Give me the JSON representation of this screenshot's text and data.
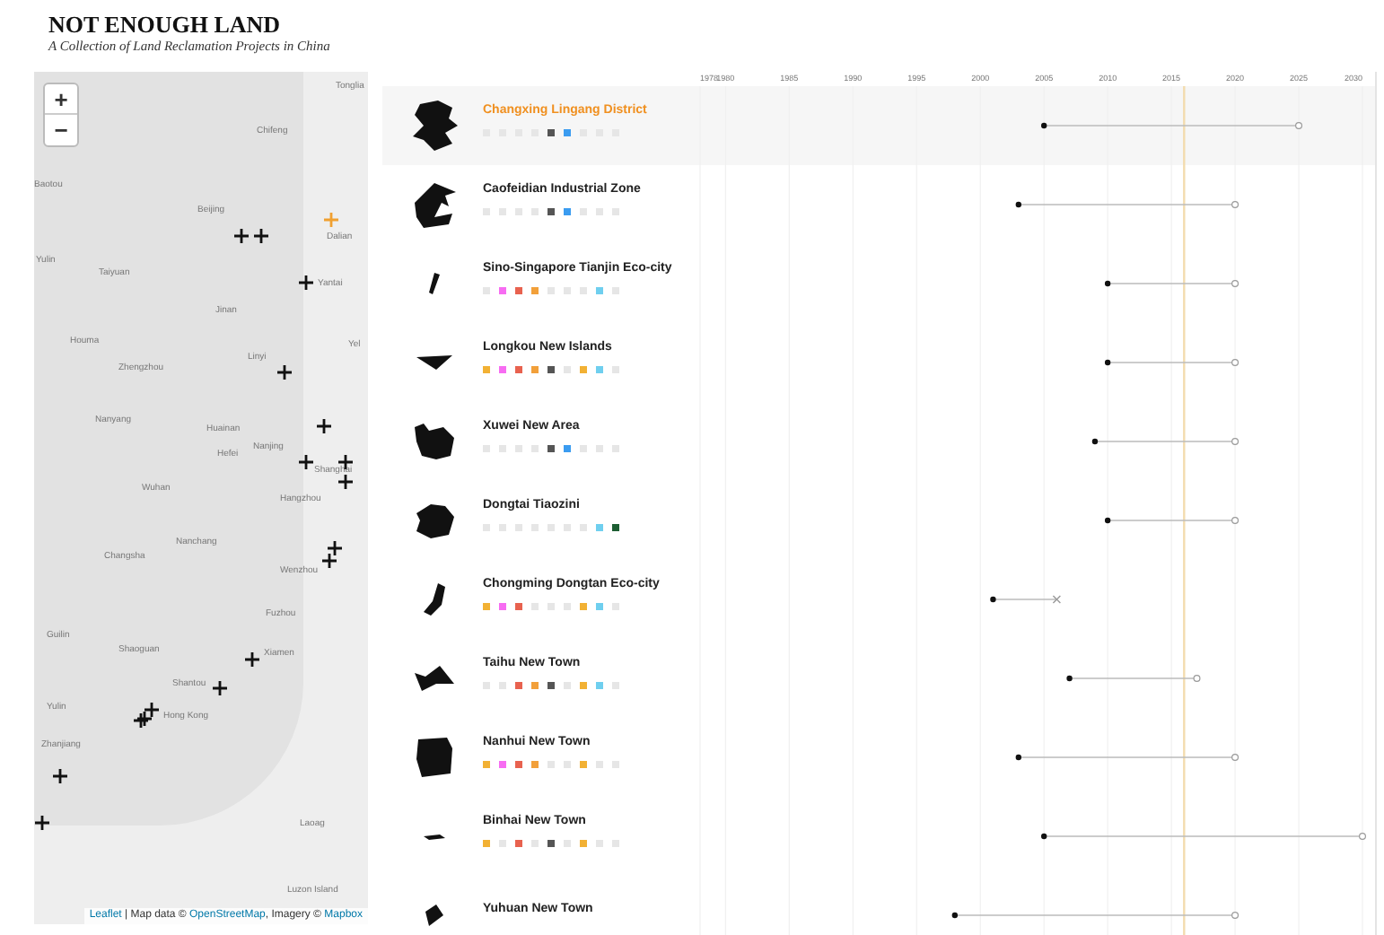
{
  "header": {
    "title": "NOT ENOUGH LAND",
    "subtitle": "A Collection of Land Reclamation Projects in China"
  },
  "map": {
    "zoom_in": "+",
    "zoom_out": "−",
    "labels": [
      "Tonglia",
      "Chifeng",
      "Baotou",
      "Beijing",
      "Dalian",
      "Yulin",
      "Taiyuan",
      "Yantai",
      "Jinan",
      "Houma",
      "Linyi",
      "Yel",
      "Zhengzhou",
      "Nanyang",
      "Huainan",
      "Nanjing",
      "Hefei",
      "Shanghai",
      "Wuhan",
      "Hangzhou",
      "Nanchang",
      "Changsha",
      "Wenzhou",
      "Fuzhou",
      "Guilin",
      "Shaoguan",
      "Xiamen",
      "Shantou",
      "Yulin",
      "Hong Kong",
      "Zhanjiang",
      "Laoag",
      "Luzon Island"
    ],
    "attribution": {
      "leaflet": "Leaflet",
      "sep": " | Map data © ",
      "osm": "OpenStreetMap",
      "imagery": ", Imagery © ",
      "mapbox": "Mapbox"
    }
  },
  "projects": [
    {
      "name": "Changxing Lingang District",
      "selected": true,
      "dots": [
        {
          "color": "#e6e6e6"
        },
        {
          "color": "#e6e6e6"
        },
        {
          "color": "#e6e6e6"
        },
        {
          "color": "#e6e6e6"
        },
        {
          "color": "#555555"
        },
        {
          "color": "#3b9cf0"
        },
        {
          "color": "#e6e6e6"
        },
        {
          "color": "#e6e6e6"
        },
        {
          "color": "#e6e6e6"
        }
      ]
    },
    {
      "name": "Caofeidian Industrial Zone",
      "selected": false,
      "dots": [
        {
          "color": "#e6e6e6"
        },
        {
          "color": "#e6e6e6"
        },
        {
          "color": "#e6e6e6"
        },
        {
          "color": "#e6e6e6"
        },
        {
          "color": "#555555"
        },
        {
          "color": "#3b9cf0"
        },
        {
          "color": "#e6e6e6"
        },
        {
          "color": "#e6e6e6"
        },
        {
          "color": "#e6e6e6"
        }
      ]
    },
    {
      "name": "Sino-Singapore Tianjin Eco-city",
      "selected": false,
      "dots": [
        {
          "color": "#e6e6e6"
        },
        {
          "color": "#f76cf2"
        },
        {
          "color": "#e8624f"
        },
        {
          "color": "#f2a03a"
        },
        {
          "color": "#e6e6e6"
        },
        {
          "color": "#e6e6e6"
        },
        {
          "color": "#e6e6e6"
        },
        {
          "color": "#6fcfef"
        },
        {
          "color": "#e6e6e6"
        }
      ]
    },
    {
      "name": "Longkou New Islands",
      "selected": false,
      "dots": [
        {
          "color": "#f2b134"
        },
        {
          "color": "#f76cf2"
        },
        {
          "color": "#e8624f"
        },
        {
          "color": "#f2a03a"
        },
        {
          "color": "#555555"
        },
        {
          "color": "#e6e6e6"
        },
        {
          "color": "#f2b134"
        },
        {
          "color": "#6fcfef"
        },
        {
          "color": "#e6e6e6"
        }
      ]
    },
    {
      "name": "Xuwei New Area",
      "selected": false,
      "dots": [
        {
          "color": "#e6e6e6"
        },
        {
          "color": "#e6e6e6"
        },
        {
          "color": "#e6e6e6"
        },
        {
          "color": "#e6e6e6"
        },
        {
          "color": "#555555"
        },
        {
          "color": "#3b9cf0"
        },
        {
          "color": "#e6e6e6"
        },
        {
          "color": "#e6e6e6"
        },
        {
          "color": "#e6e6e6"
        }
      ]
    },
    {
      "name": "Dongtai Tiaozini",
      "selected": false,
      "dots": [
        {
          "color": "#e6e6e6"
        },
        {
          "color": "#e6e6e6"
        },
        {
          "color": "#e6e6e6"
        },
        {
          "color": "#e6e6e6"
        },
        {
          "color": "#e6e6e6"
        },
        {
          "color": "#e6e6e6"
        },
        {
          "color": "#e6e6e6"
        },
        {
          "color": "#6fcfef"
        },
        {
          "color": "#1d5e33"
        }
      ]
    },
    {
      "name": "Chongming Dongtan Eco-city",
      "selected": false,
      "dots": [
        {
          "color": "#f2b134"
        },
        {
          "color": "#f76cf2"
        },
        {
          "color": "#e8624f"
        },
        {
          "color": "#e6e6e6"
        },
        {
          "color": "#e6e6e6"
        },
        {
          "color": "#e6e6e6"
        },
        {
          "color": "#f2b134"
        },
        {
          "color": "#6fcfef"
        },
        {
          "color": "#e6e6e6"
        }
      ]
    },
    {
      "name": "Taihu New Town",
      "selected": false,
      "dots": [
        {
          "color": "#e6e6e6"
        },
        {
          "color": "#e6e6e6"
        },
        {
          "color": "#e8624f"
        },
        {
          "color": "#f2a03a"
        },
        {
          "color": "#555555"
        },
        {
          "color": "#e6e6e6"
        },
        {
          "color": "#f2b134"
        },
        {
          "color": "#6fcfef"
        },
        {
          "color": "#e6e6e6"
        }
      ]
    },
    {
      "name": "Nanhui New Town",
      "selected": false,
      "dots": [
        {
          "color": "#f2b134"
        },
        {
          "color": "#f76cf2"
        },
        {
          "color": "#e8624f"
        },
        {
          "color": "#f2a03a"
        },
        {
          "color": "#e6e6e6"
        },
        {
          "color": "#e6e6e6"
        },
        {
          "color": "#f2b134"
        },
        {
          "color": "#e6e6e6"
        },
        {
          "color": "#e6e6e6"
        }
      ]
    },
    {
      "name": "Binhai New Town",
      "selected": false,
      "dots": [
        {
          "color": "#f2b134"
        },
        {
          "color": "#e6e6e6"
        },
        {
          "color": "#e8624f"
        },
        {
          "color": "#e6e6e6"
        },
        {
          "color": "#555555"
        },
        {
          "color": "#e6e6e6"
        },
        {
          "color": "#f2b134"
        },
        {
          "color": "#e6e6e6"
        },
        {
          "color": "#e6e6e6"
        }
      ]
    },
    {
      "name": "Yuhuan New Town",
      "selected": false
    }
  ],
  "timeline": {
    "chart_data": {
      "type": "scatter",
      "orientation": "horizontal",
      "xlim": [
        1978,
        2030
      ],
      "xticks": [
        1978,
        1980,
        1985,
        1990,
        1995,
        2000,
        2005,
        2010,
        2015,
        2020,
        2025,
        2030
      ],
      "series": [
        {
          "color": "#111111",
          "values": [
            2005,
            2003,
            2010,
            2010,
            2009,
            2010,
            2001,
            2007,
            2003,
            2005,
            1998
          ]
        },
        {
          "color": "#999999",
          "values": [
            2025,
            2020,
            2020,
            2020,
            2020,
            2020,
            null,
            2017,
            2020,
            2030,
            2020
          ]
        },
        {
          "color": "#999999",
          "values": [
            null,
            null,
            null,
            null,
            null,
            null,
            2006,
            null,
            null,
            null,
            null
          ]
        }
      ],
      "grid": true,
      "ref_lines": [
        {
          "axis": "x",
          "value": 2016,
          "color": "#f3dcae"
        }
      ]
    }
  }
}
